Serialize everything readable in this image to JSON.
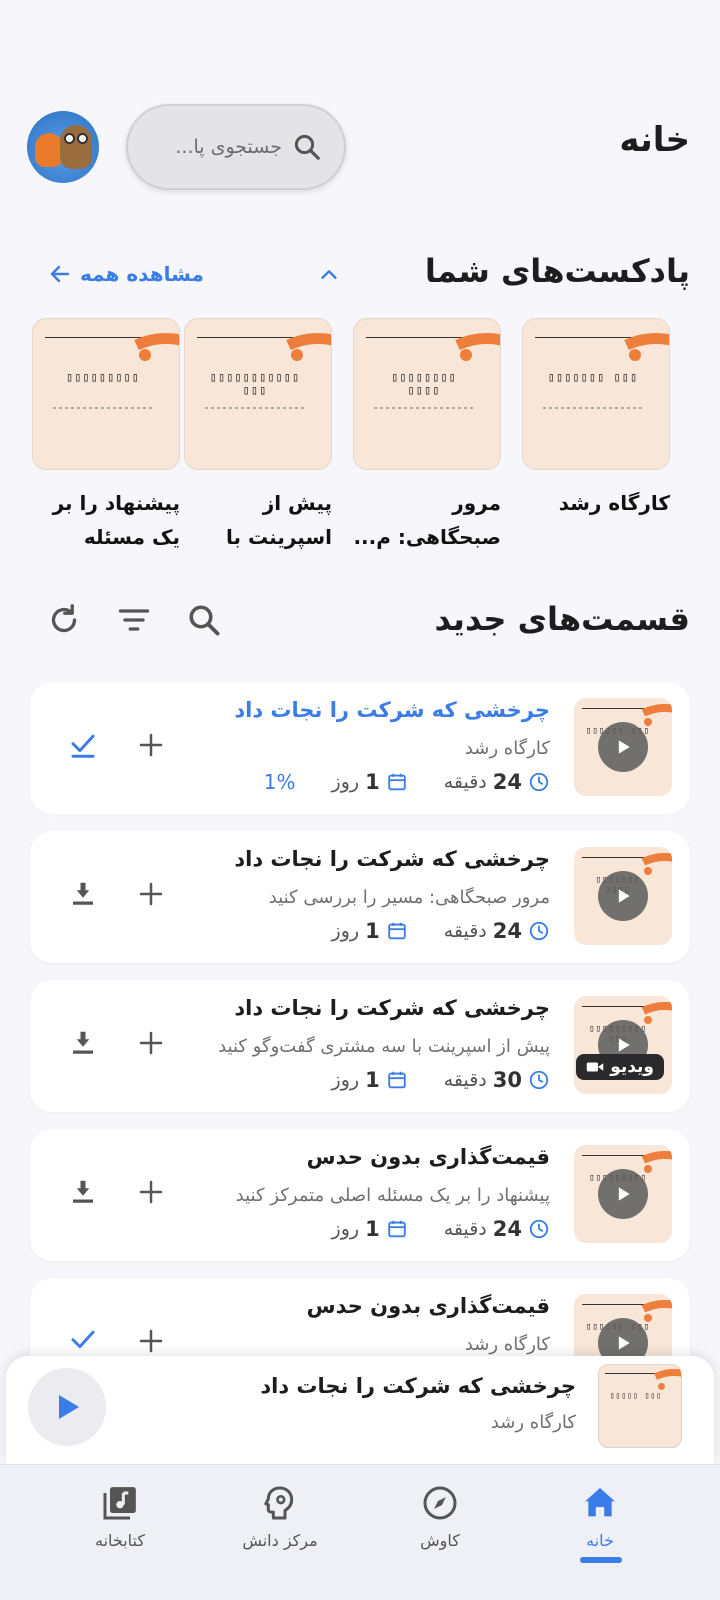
{
  "header": {
    "title": "خانه",
    "search_placeholder": "جستجوی پا..."
  },
  "podcasts_section": {
    "title": "پادکست‌های شما",
    "see_all": "مشاهده همه",
    "items": [
      {
        "title": "کارگاه رشد",
        "cover_text": "▯▯▯▯▯▯▯ ▯▯▯"
      },
      {
        "title": "مرور صبحگاهی: م...",
        "cover_text": "▯▯▯▯▯▯▯▯ ▯▯▯▯"
      },
      {
        "title": "پیش از اسپرینت با س...",
        "cover_text": "▯▯▯▯▯▯▯▯▯▯▯ ▯▯▯"
      },
      {
        "title": "پیشنهاد را بر یک مسئله اص...",
        "cover_text": "▯▯▯▯▯▯▯▯▯"
      }
    ]
  },
  "episodes_section": {
    "title": "قسمت‌های جدید",
    "items": [
      {
        "title": "چرخشی که شرکت را نجات داد",
        "podcast": "کارگاه رشد",
        "duration": "24",
        "duration_unit": "دقیقه",
        "age": "1",
        "age_unit": "روز",
        "progress": "1%",
        "action": "done",
        "active": true,
        "thumb_text": "▯▯▯▯▯▯ ▯▯▯"
      },
      {
        "title": "چرخشی که شرکت را نجات داد",
        "podcast": "مرور صبحگاهی: مسیر را بررسی کنید",
        "duration": "24",
        "duration_unit": "دقیقه",
        "age": "1",
        "age_unit": "روز",
        "action": "download",
        "thumb_text": "▯▯▯▯▯▯▯ ▯▯▯▯"
      },
      {
        "title": "چرخشی که شرکت را نجات داد",
        "podcast": "پیش از اسپرینت با سه مشتری گفت‌وگو کنید",
        "duration": "30",
        "duration_unit": "دقیقه",
        "age": "1",
        "age_unit": "روز",
        "action": "download",
        "video_label": "ویدیو",
        "thumb_text": "▯▯▯▯▯▯▯▯▯ ▯▯▯"
      },
      {
        "title": "قیمت‌گذاری بدون حدس",
        "podcast": "پیشنهاد را بر یک مسئله اصلی متمرکز کنید",
        "duration": "24",
        "duration_unit": "دقیقه",
        "age": "1",
        "age_unit": "روز",
        "action": "download",
        "thumb_text": "▯▯▯▯▯▯▯▯▯"
      },
      {
        "title": "قیمت‌گذاری بدون حدس",
        "podcast": "کارگاه رشد",
        "action": "done",
        "thumb_text": "▯▯▯▯▯▯ ▯▯▯"
      }
    ]
  },
  "mini_player": {
    "title": "چرخشی که شرکت را نجات داد",
    "podcast": "کارگاه رشد",
    "thumb_text": "▯▯▯▯▯ ▯▯▯"
  },
  "bottom_nav": {
    "home": "خانه",
    "explore": "کاوش",
    "knowledge": "مرکز دانش",
    "library": "کتابخانه"
  },
  "colors": {
    "accent": "#3b7de8",
    "cover_bg": "#f8e6d8",
    "cover_accent": "#ee7e3c"
  },
  "icons": [
    "search-icon",
    "avatar",
    "chevron-up-icon",
    "arrow-left-icon",
    "refresh-icon",
    "filter-icon",
    "play-icon",
    "check-icon",
    "download-icon",
    "plus-icon",
    "clock-icon",
    "calendar-icon",
    "video-icon",
    "home-icon",
    "compass-icon",
    "brain-icon",
    "library-icon"
  ]
}
